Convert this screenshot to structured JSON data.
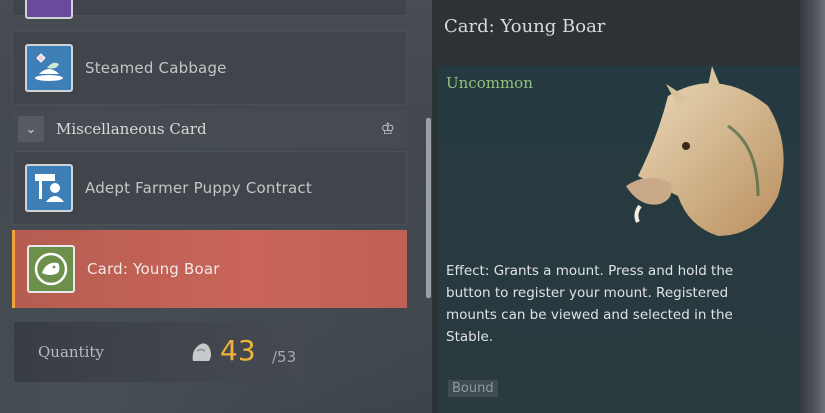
{
  "list": {
    "items": [
      {
        "label": "Steamed Cabbage",
        "icon": "cabbage-dish-icon"
      },
      {
        "label": "Adept Farmer Puppy Contract",
        "icon": "signpost-contract-icon"
      },
      {
        "label": "Card: Young Boar",
        "icon": "boar-card-icon",
        "selected": true
      }
    ],
    "category": {
      "label": "Miscellaneous Card",
      "collapse_icon": "chevron-down-icon",
      "filter_icon": "crown-icon"
    }
  },
  "quantity": {
    "label": "Quantity",
    "value": "43",
    "max": "/53",
    "icon": "stone-pile-icon"
  },
  "detail": {
    "title": "Card: Young Boar",
    "rarity": "Uncommon",
    "effect": "Effect: Grants a mount. Press and hold the button to register your mount. Registered mounts can be viewed and selected in the Stable.",
    "bound": "Bound",
    "art": "young-boar-illustration"
  },
  "colors": {
    "selected_row": "#c9655a",
    "rarity_uncommon": "#8fc37a",
    "quantity_accent": "#f2b23a",
    "icon_blue": "#3d7fb6",
    "icon_green": "#6c8f4a"
  }
}
